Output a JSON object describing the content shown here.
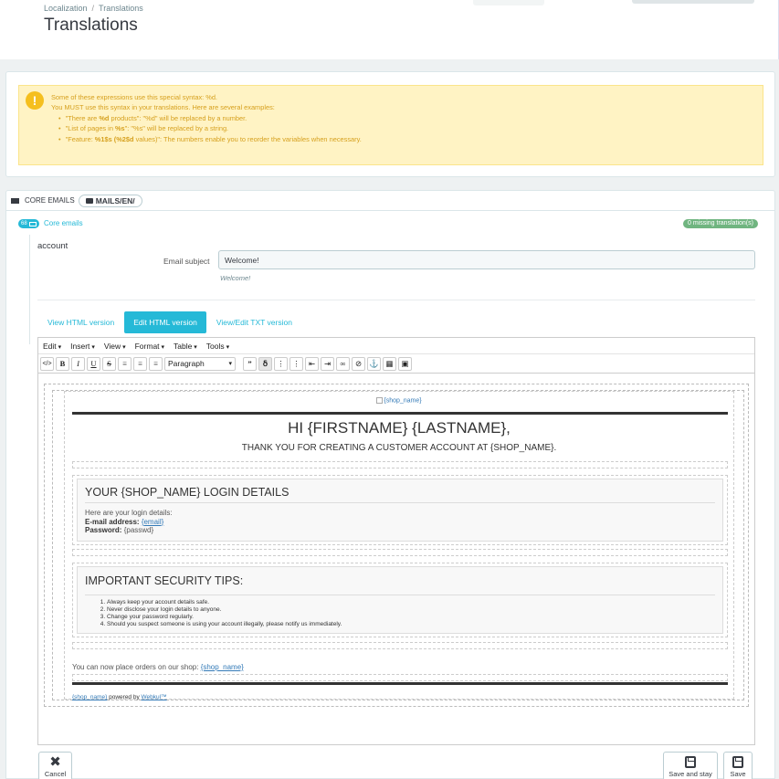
{
  "header": {
    "breadcrumb": [
      "Localization",
      "Translations"
    ],
    "breadcrumb_sep": "/",
    "title": "Translations"
  },
  "alert": {
    "icon": "!",
    "line1": "Some of these expressions use this special syntax: %d.",
    "line2": "You MUST use this syntax in your translations. Here are several examples:",
    "examples": [
      {
        "pre": "\"There are ",
        "bold": "%d",
        "post": " products\": \"%d\" will be replaced by a number."
      },
      {
        "pre": "\"List of pages in ",
        "bold": "%s",
        "post": "\": \"%s\" will be replaced by a string."
      },
      {
        "pre": "\"Feature: ",
        "bold": "%1$s (%2$d",
        "post": " values)\": The numbers enable you to reorder the variables when necessary."
      }
    ],
    "colors": {
      "bg": "#fff3c4",
      "text": "#d6a01e",
      "icon": "#f5bf1e"
    }
  },
  "panel": {
    "crumb_core": "CORE EMAILS",
    "crumb_folder": "MAILS/EN/",
    "core_badge_count": "68",
    "core_link": "Core emails",
    "missing_badge": "0 missing translation(s)",
    "group_title": "account",
    "subject_label": "Email subject",
    "subject_value": "Welcome!",
    "subject_hint": "Welcome!",
    "tabs": [
      "View HTML version",
      "Edit HTML version",
      "View/Edit TXT version"
    ],
    "active_tab": 1,
    "accent": "#25b9d7"
  },
  "editor": {
    "menus": [
      "Edit",
      "Insert",
      "View",
      "Format",
      "Table",
      "Tools"
    ],
    "format_select": "Paragraph",
    "toolbar_buttons": {
      "code": "</>",
      "bold": "B",
      "italic": "I",
      "underline": "U",
      "strike": "S"
    }
  },
  "mail": {
    "logo_alt": "{shop_name}",
    "greeting": "HI {FIRSTNAME} {LASTNAME},",
    "thanks": "THANK YOU FOR CREATING A CUSTOMER ACCOUNT AT {SHOP_NAME}.",
    "login_title": "YOUR {SHOP_NAME} LOGIN DETAILS",
    "login_intro": "Here are your login details:",
    "email_label": "E-mail address:",
    "email_value": "{email}",
    "password_label": "Password:",
    "password_value": "{passwd}",
    "tips_title": "IMPORTANT SECURITY TIPS:",
    "tips": [
      "Always keep your account details safe.",
      "Never disclose your login details to anyone.",
      "Change your password regularly.",
      "Should you suspect someone is using your account illegally, please notify us immediately."
    ],
    "place_text": "You can now place orders on our shop: ",
    "place_link": "{shop_name}",
    "footer_link": "{shop_name}",
    "footer_powered": " powered by ",
    "footer_vendor": "Webkul™"
  },
  "actions": {
    "cancel": "Cancel",
    "save_stay": "Save and stay",
    "save": "Save"
  }
}
